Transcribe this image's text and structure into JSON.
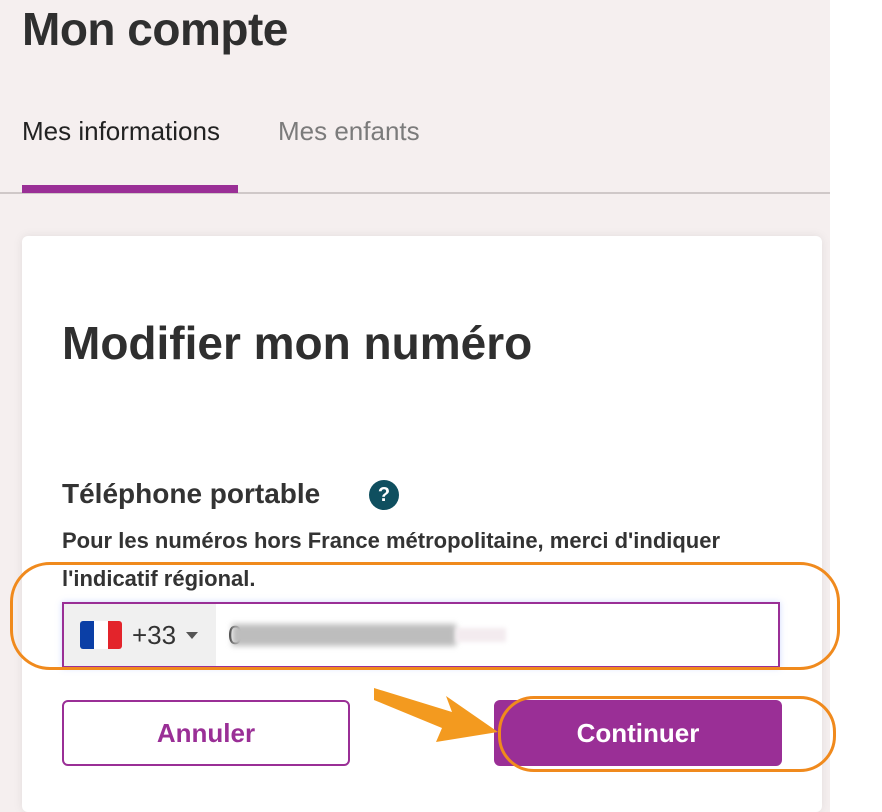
{
  "header": {
    "title": "Mon compte",
    "tabs": [
      {
        "label": "Mes informations",
        "active": true
      },
      {
        "label": "Mes enfants",
        "active": false
      }
    ]
  },
  "modal": {
    "title": "Modifier mon numéro",
    "field_label": "Téléphone portable",
    "help_icon": "question-circle-icon",
    "help_glyph": "?",
    "hint": "Pour les numéros hors France métropolitaine, merci d'indiquer l'indicatif régional.",
    "country": {
      "flag": "france-flag-icon",
      "dial_code": "+33"
    },
    "number_value": "0",
    "cancel_label": "Annuler",
    "continue_label": "Continuer"
  },
  "colors": {
    "accent": "#9a2f96",
    "annotation": "#f08a1d",
    "help_icon": "#0f4f5f",
    "page_background": "#f5efef"
  }
}
